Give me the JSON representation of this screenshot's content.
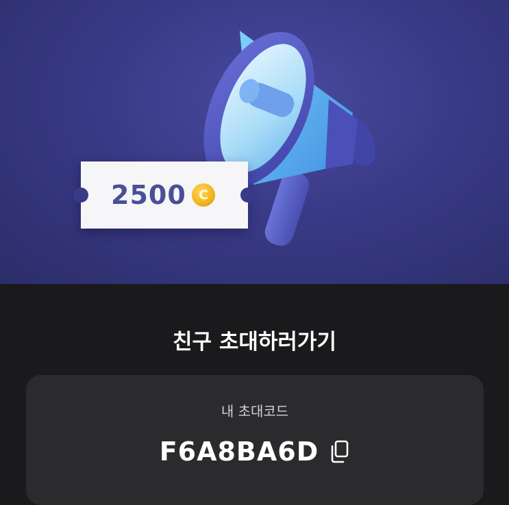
{
  "banner": {
    "ticket_amount": "2500",
    "coin_symbol": "C",
    "colors": {
      "background": "#393a86",
      "megaphone_body": "#5b60c9",
      "megaphone_inner": "#6fc4f5",
      "coin": "#f2b21c"
    }
  },
  "invite": {
    "title": "친구 초대하러가기"
  },
  "code_card": {
    "label": "내 초대코드",
    "code": "F6A8BA6D",
    "copy_icon": "copy-icon"
  }
}
